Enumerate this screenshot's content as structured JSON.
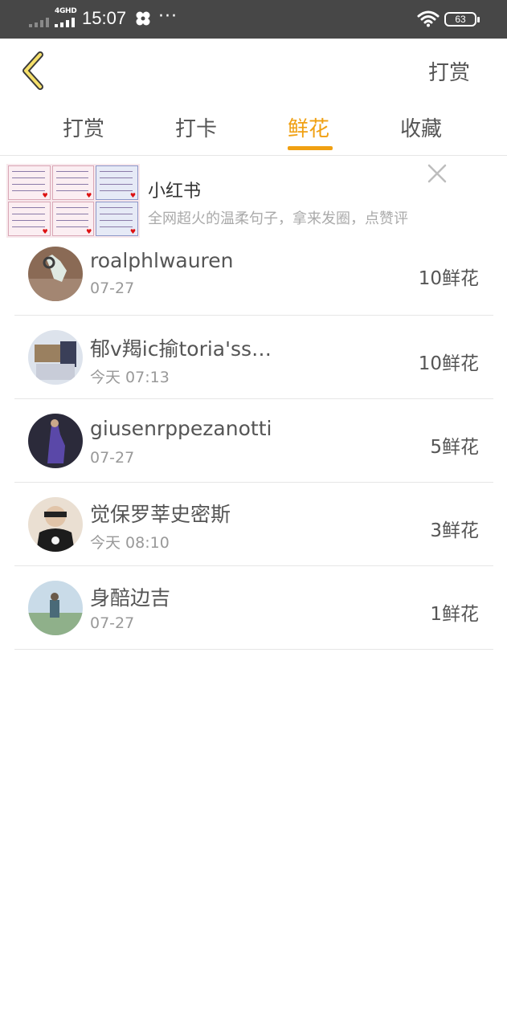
{
  "status_bar": {
    "network": "4GHD",
    "time": "15:07",
    "more": "···",
    "battery": "63"
  },
  "header": {
    "action_label": "打赏"
  },
  "tabs": [
    {
      "label": "打赏",
      "active": false
    },
    {
      "label": "打卡",
      "active": false
    },
    {
      "label": "鲜花",
      "active": true
    },
    {
      "label": "收藏",
      "active": false
    }
  ],
  "ad": {
    "title": "小红书",
    "description": "全网超火的温柔句子，拿来发圈，点赞评"
  },
  "colors": {
    "accent": "#f0a012",
    "status_bar": "#474747",
    "divider": "#e6e6e6"
  },
  "list": [
    {
      "name": "roalphlwauren",
      "date": "07-27",
      "amount": "10鲜花"
    },
    {
      "name": "郁v羯ic揄toria'ss…",
      "date": "今天 07:13",
      "amount": "10鲜花"
    },
    {
      "name": "giusenrppezanotti",
      "date": "07-27",
      "amount": "5鲜花"
    },
    {
      "name": "觉保罗莘史密斯",
      "date": "今天 08:10",
      "amount": "3鲜花"
    },
    {
      "name": "身醅边吉",
      "date": "07-27",
      "amount": "1鲜花"
    }
  ]
}
